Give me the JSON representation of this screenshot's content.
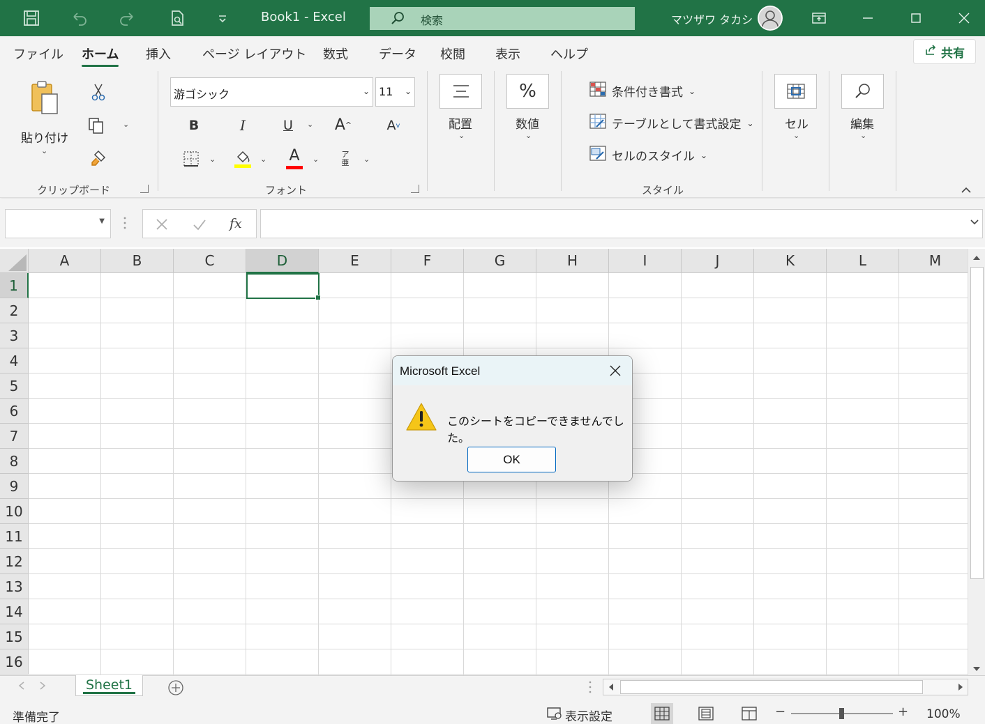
{
  "titlebar": {
    "title": "Book1  -  Excel",
    "search_placeholder": "検索",
    "user_name": "マツザワ タカシ",
    "brand_color": "#217346",
    "icons": [
      "save-icon",
      "undo-icon",
      "redo-icon",
      "print-preview-icon",
      "customize-qat-icon",
      "ribbon-display-icon",
      "minimize-icon",
      "maximize-icon",
      "close-icon"
    ]
  },
  "menu": {
    "tabs": [
      "ファイル",
      "ホーム",
      "挿入",
      "ページ レイアウト",
      "数式",
      "データ",
      "校閲",
      "表示",
      "ヘルプ"
    ],
    "active_tab": "ホーム",
    "share_label": "共有"
  },
  "ribbon": {
    "clipboard": {
      "paste_label": "貼り付け",
      "group_label": "クリップボード"
    },
    "font": {
      "font_name": "游ゴシック",
      "font_size": "11",
      "bold": "B",
      "italic": "I",
      "underline": "U",
      "grow": "A",
      "shrink": "A",
      "font_color_letter": "A",
      "phonetic_top": "ア",
      "phonetic_bottom": "亜",
      "group_label": "フォント"
    },
    "alignment": {
      "label": "配置"
    },
    "number": {
      "symbol": "%",
      "label": "数値"
    },
    "styles": {
      "conditional": "条件付き書式",
      "table": "テーブルとして書式設定",
      "cell_styles": "セルのスタイル",
      "group_label": "スタイル"
    },
    "cells": {
      "label": "セル"
    },
    "editing": {
      "label": "編集"
    }
  },
  "formula_bar": {
    "name_box": "",
    "fx": "fx",
    "formula": ""
  },
  "grid": {
    "columns": [
      "A",
      "B",
      "C",
      "D",
      "E",
      "F",
      "G",
      "H",
      "I",
      "J",
      "K",
      "L",
      "M"
    ],
    "rows": [
      "1",
      "2",
      "3",
      "4",
      "5",
      "6",
      "7",
      "8",
      "9",
      "10",
      "11",
      "12",
      "13",
      "14",
      "15",
      "16"
    ],
    "active_cell": "D1"
  },
  "sheets": {
    "tabs": [
      "Sheet1"
    ],
    "active": "Sheet1"
  },
  "status": {
    "ready": "準備完了",
    "display_settings": "表示設定",
    "zoom": "100%",
    "zoom_minus": "−",
    "zoom_plus": "+"
  },
  "dialog": {
    "title": "Microsoft Excel",
    "message": "このシートをコピーできませんでした。",
    "ok_label": "OK",
    "icon": "warning-icon",
    "warning_color": "#f5c518"
  }
}
